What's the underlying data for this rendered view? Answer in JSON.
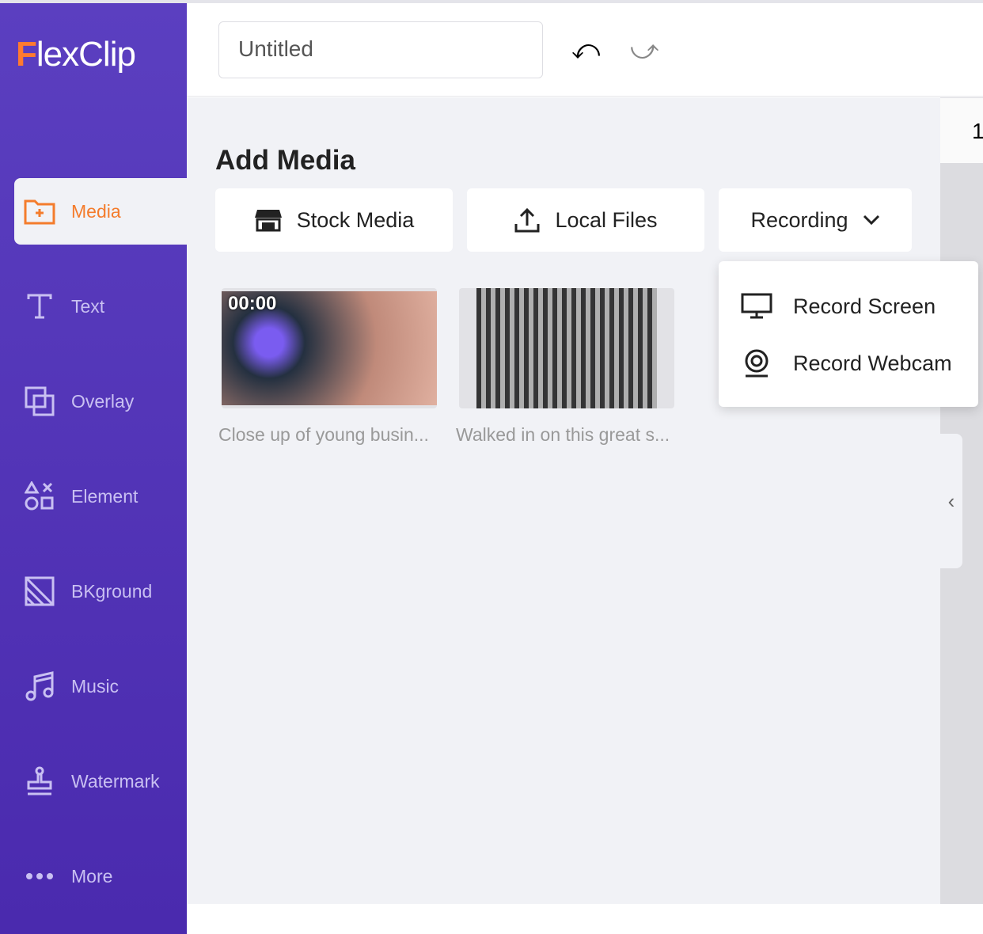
{
  "app": {
    "logo": "FlexClip"
  },
  "sidebar": {
    "items": [
      {
        "label": "Media",
        "icon": "folder-plus-icon",
        "selected": true
      },
      {
        "label": "Text",
        "icon": "text-icon"
      },
      {
        "label": "Overlay",
        "icon": "overlay-icon"
      },
      {
        "label": "Element",
        "icon": "shapes-icon"
      },
      {
        "label": "BKground",
        "icon": "background-icon"
      },
      {
        "label": "Music",
        "icon": "music-icon"
      },
      {
        "label": "Watermark",
        "icon": "stamp-icon"
      },
      {
        "label": "More",
        "icon": "more-icon"
      }
    ]
  },
  "header": {
    "title_value": "Untitled"
  },
  "main": {
    "heading": "Add Media",
    "stock_media": "Stock Media",
    "local_files": "Local Files",
    "recording": "Recording",
    "media": [
      {
        "duration": "00:00",
        "caption": "Close up of young busin..."
      },
      {
        "caption": "Walked in on this great s..."
      }
    ]
  },
  "recording_menu": [
    "Record Screen",
    "Record Webcam"
  ],
  "right_panel": {
    "value": "1"
  },
  "colors": {
    "sidebar": "#5b3fc0",
    "accent": "#f47c2c",
    "panel": "#f1f2f6"
  }
}
